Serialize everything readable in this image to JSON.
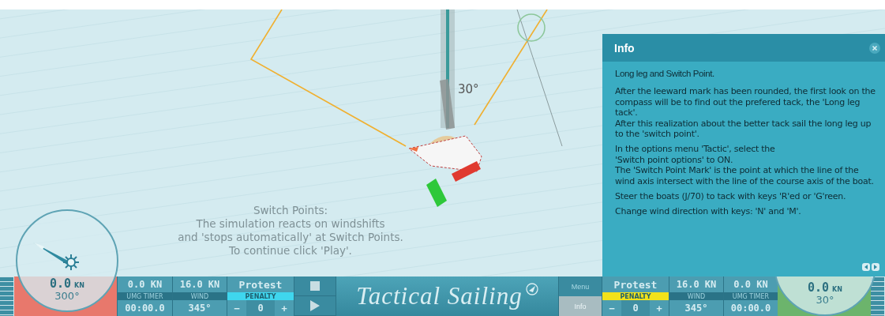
{
  "sea": {
    "angle_label": "30°",
    "note": "Switch Points:\nThe simulation reacts on windshifts\nand 'stops automatically' at Switch Points.\nTo continue click 'Play'."
  },
  "info_panel": {
    "title": "Info",
    "paragraphs": [
      "Long leg and Switch Point.",
      "After the leeward mark has been rounded, the first look on the compass will be to find out the prefered tack, the 'Long leg tack'.\nAfter this realization about the better tack sail the long leg up to the 'switch point'.",
      "In the options menu 'Tactic', select the\n'Switch point options' to ON.\nThe 'Switch Point Mark' is the point at which the line of the wind axis intersect with the line of the course axis of the boat.",
      "Steer the boats (J/70) to tack with keys 'R'ed or 'G'reen.",
      "Change wind direction with keys: 'N' and 'M'."
    ]
  },
  "sides": [
    {
      "kind": "left",
      "color": "#e8786c",
      "speed": "0.0",
      "speed_unit": "KN",
      "heading": "300°",
      "vmg": "0.0 KN",
      "vmg_label": "UMG TIMER",
      "timer": "00:00.0",
      "wind": "16.0 KN",
      "wind_label": "WIND",
      "wind_direction": "345°",
      "protest": "Protest",
      "penalty": {
        "label": "PENALTY",
        "color": "#3fd6ee"
      },
      "minus": "−",
      "count": "0",
      "plus": "+"
    },
    {
      "kind": "right",
      "color": "#6cb46c",
      "speed": "0.0",
      "speed_unit": "KN",
      "heading": "30°",
      "vmg": "0.0 KN",
      "vmg_label": "UMG TIMER",
      "timer": "00:00.0",
      "wind": "16.0 KN",
      "wind_label": "WIND",
      "wind_direction": "345°",
      "protest": "Protest",
      "penalty": {
        "label": "PENALTY",
        "color": "#f2e21a"
      },
      "minus": "−",
      "count": "0",
      "plus": "+"
    }
  ],
  "logo": "Tactical Sailing",
  "menu": [
    {
      "label": "Menu",
      "selected": false
    },
    {
      "label": "Info",
      "selected": true
    }
  ]
}
